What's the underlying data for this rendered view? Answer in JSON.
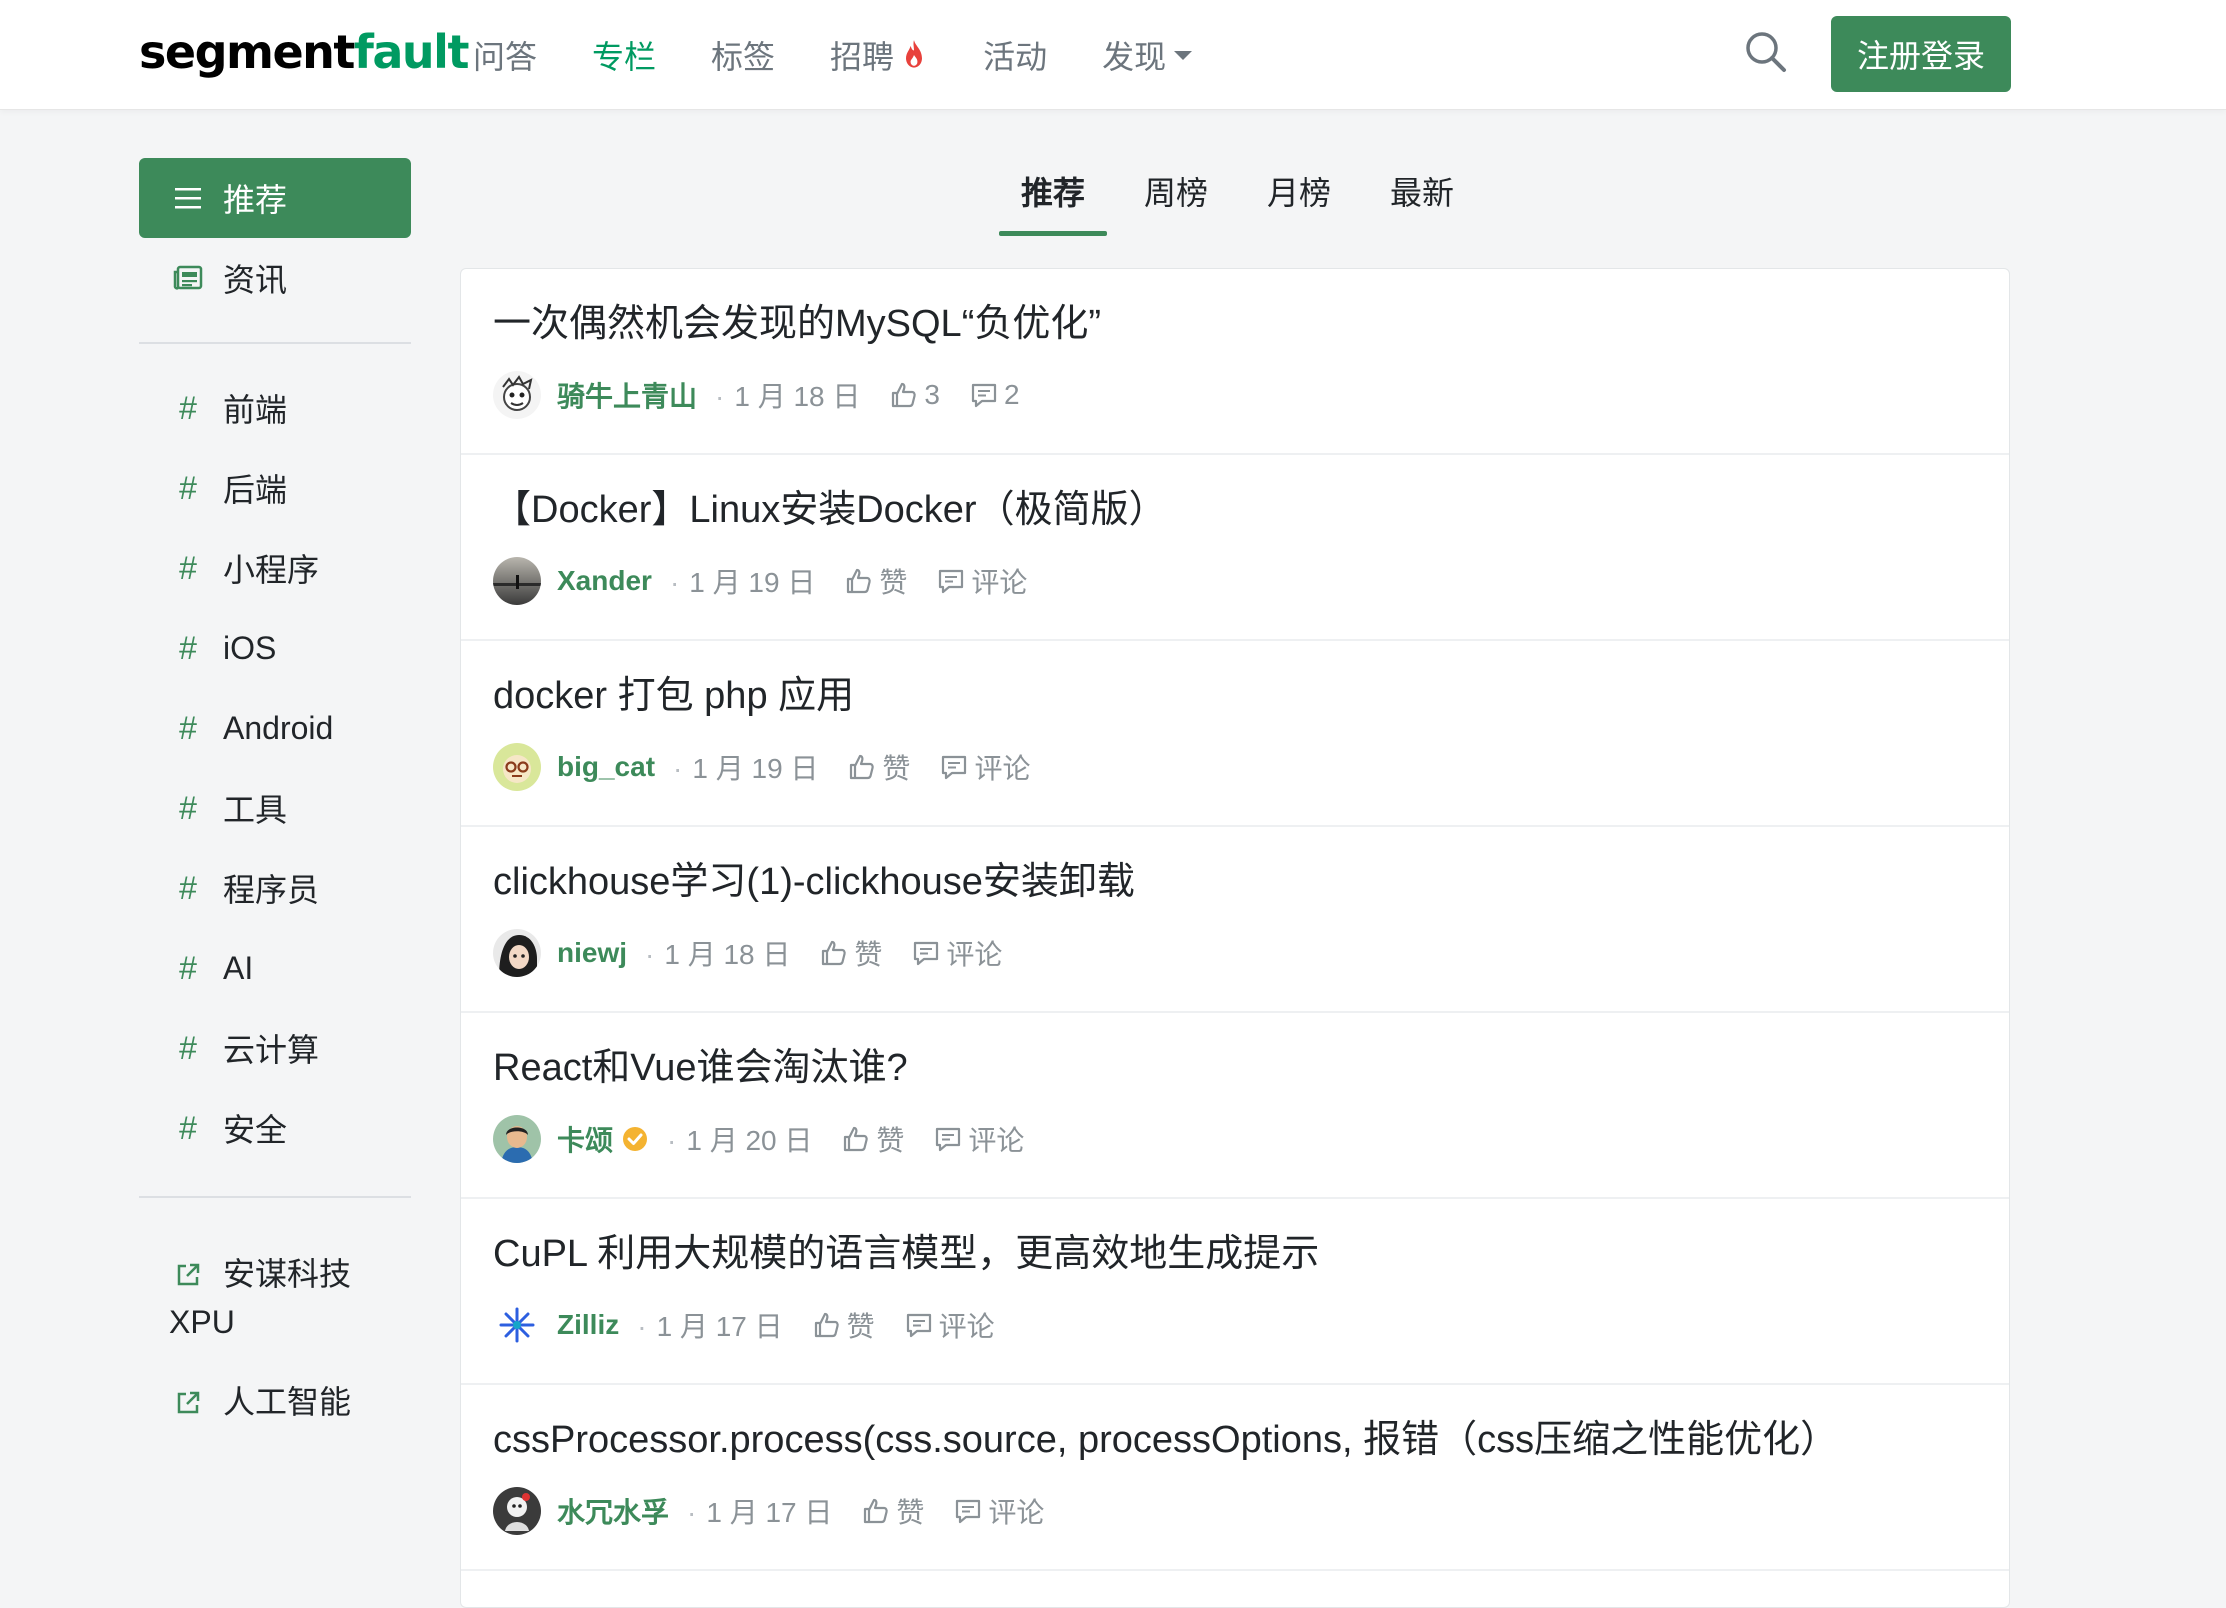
{
  "header": {
    "logo_part1": "segment",
    "logo_part2": "fault",
    "nav": [
      {
        "label": "问答",
        "active": false
      },
      {
        "label": "专栏",
        "active": true
      },
      {
        "label": "标签",
        "active": false
      },
      {
        "label": "招聘",
        "active": false,
        "icon": "fire-icon"
      },
      {
        "label": "活动",
        "active": false
      },
      {
        "label": "发现",
        "active": false,
        "dropdown": true
      }
    ],
    "search_icon": "search-icon",
    "login_label": "注册登录"
  },
  "sidebar": {
    "main": [
      {
        "label": "推荐",
        "icon": "menu-icon",
        "active": true
      },
      {
        "label": "资讯",
        "icon": "news-icon",
        "active": false
      }
    ],
    "tags": [
      "前端",
      "后端",
      "小程序",
      "iOS",
      "Android",
      "工具",
      "程序员",
      "AI",
      "云计算",
      "安全"
    ],
    "hash": "#",
    "external": [
      {
        "label": "安谋科技 XPU",
        "icon": "external-link-icon"
      },
      {
        "label": "人工智能",
        "icon": "external-link-icon"
      }
    ]
  },
  "tabs": [
    {
      "label": "推荐",
      "active": true
    },
    {
      "label": "周榜",
      "active": false
    },
    {
      "label": "月榜",
      "active": false
    },
    {
      "label": "最新",
      "active": false
    }
  ],
  "articles": [
    {
      "title": "一次偶然机会发现的MySQL“负优化”",
      "author": "骑牛上青山",
      "date": "1 月 18 日",
      "likes": "3",
      "comments": "2",
      "verified": false
    },
    {
      "title": "【Docker】Linux安装Docker（极简版）",
      "author": "Xander",
      "date": "1 月 19 日",
      "likes": "赞",
      "comments": "评论",
      "verified": false
    },
    {
      "title": "docker 打包 php 应用",
      "author": "big_cat",
      "date": "1 月 19 日",
      "likes": "赞",
      "comments": "评论",
      "verified": false
    },
    {
      "title": "clickhouse学习(1)-clickhouse安装卸载",
      "author": "niewj",
      "date": "1 月 18 日",
      "likes": "赞",
      "comments": "评论",
      "verified": false
    },
    {
      "title": "React和Vue谁会淘汰谁?",
      "author": "卡颂",
      "date": "1 月 20 日",
      "likes": "赞",
      "comments": "评论",
      "verified": true
    },
    {
      "title": "CuPL 利用大规模的语言模型，更高效地生成提示",
      "author": "Zilliz",
      "date": "1 月 17 日",
      "likes": "赞",
      "comments": "评论",
      "verified": false
    },
    {
      "title": "cssProcessor.process(css.source, processOptions, 报错（css压缩之性能优化）",
      "author": "水冗水孚",
      "date": "1 月 17 日",
      "likes": "赞",
      "comments": "评论",
      "verified": false
    }
  ],
  "colors": {
    "brand": "#3d8a5a",
    "logo_green": "#009a61",
    "text": "#212529",
    "muted": "#8b9297"
  }
}
